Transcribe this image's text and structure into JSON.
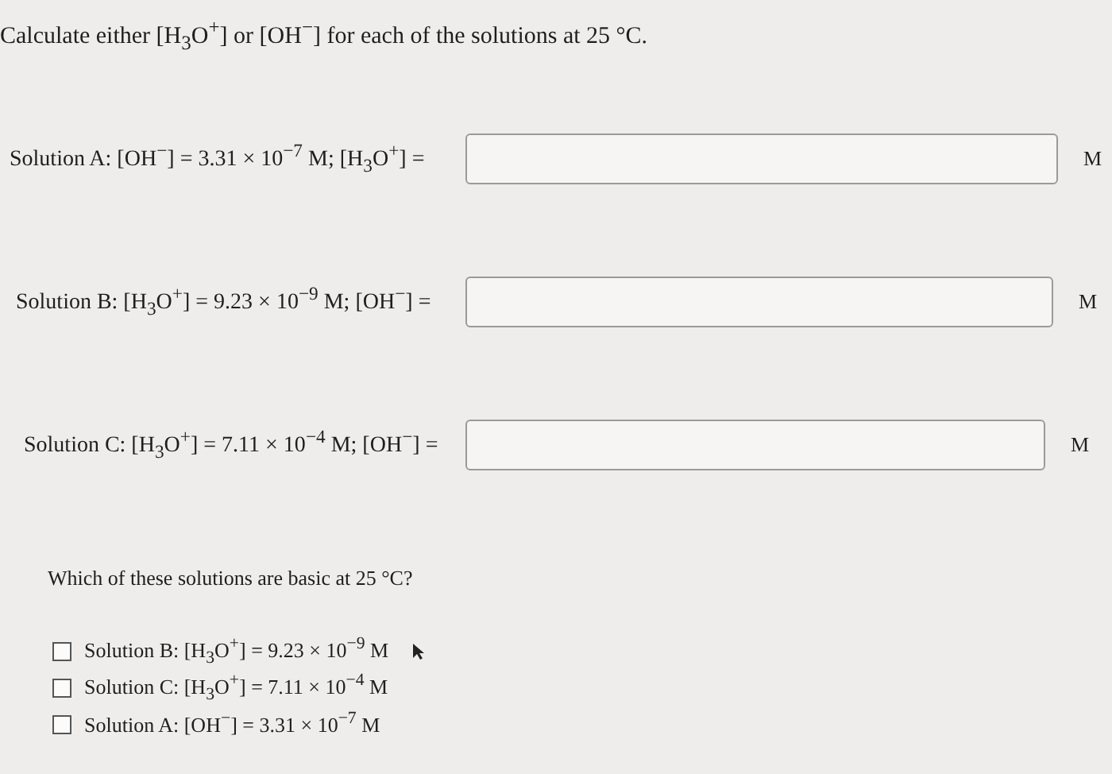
{
  "instruction": "Calculate either [H$_{3}$O$^{+}$] or [OH$^{−}$] for each of the solutions at 25 °C.",
  "answers": [
    {
      "label": "Solution A: [OH$^{−}$] = 3.31 × 10$^{−7}$ M; [H$_{3}$O$^{+}$] =",
      "unit": "M"
    },
    {
      "label": "Solution B: [H$_{3}$O$^{+}$] = 9.23 × 10$^{−9}$ M; [OH$^{−}$] =",
      "unit": "M"
    },
    {
      "label": "Solution C: [H$_{3}$O$^{+}$] = 7.11 × 10$^{−4}$ M; [OH$^{−}$] =",
      "unit": "M"
    }
  ],
  "question": "Which of these solutions are basic at 25 °C?",
  "choices": [
    {
      "label": "Solution B: [H$_{3}$O$^{+}$] = 9.23 × 10$^{−9}$ M",
      "checked": false
    },
    {
      "label": "Solution C: [H$_{3}$O$^{+}$] = 7.11 × 10$^{−4}$ M",
      "checked": false
    },
    {
      "label": "Solution A: [OH$^{−}$] = 3.31 × 10$^{−7}$ M",
      "checked": false
    }
  ]
}
